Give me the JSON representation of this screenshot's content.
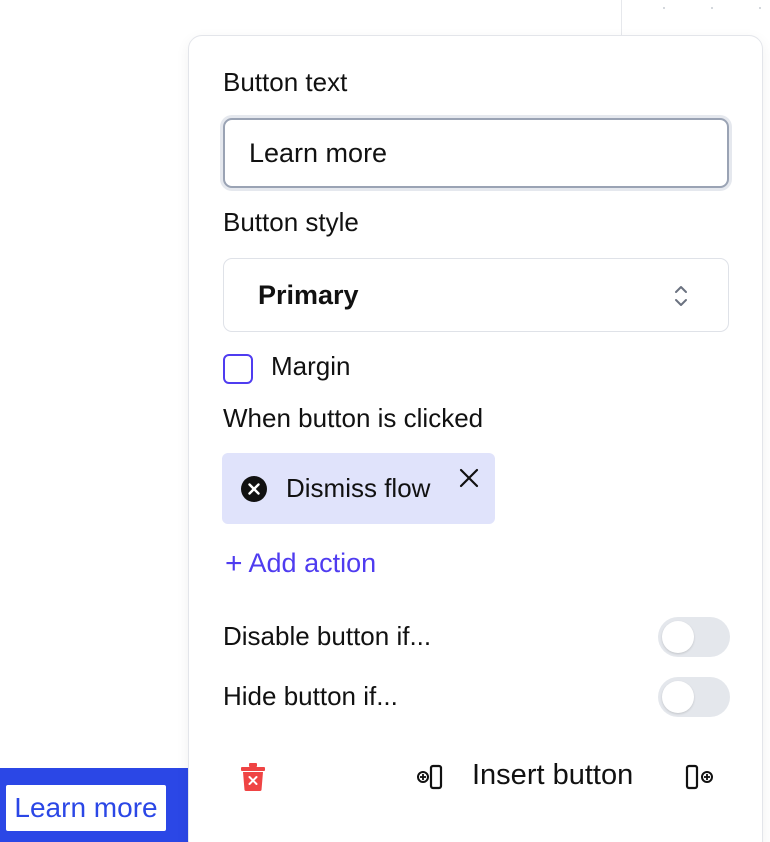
{
  "preview": {
    "button_label": "Learn more"
  },
  "panel": {
    "button_text_label": "Button text",
    "button_text_value": "Learn more",
    "button_style_label": "Button style",
    "button_style_selected": "Primary",
    "margin_label": "Margin",
    "margin_checked": false,
    "click_label": "When button is clicked",
    "actions": [
      {
        "label": "Dismiss flow",
        "icon": "x-circle-icon"
      }
    ],
    "add_action_label": "Add action",
    "disable_label": "Disable button if...",
    "disable_on": false,
    "hide_label": "Hide button if...",
    "hide_on": false,
    "insert_button_label": "Insert button"
  },
  "colors": {
    "accent": "#4f3cf0",
    "preview_bg": "#2b47e6",
    "chip_bg": "#e0e3fb",
    "danger": "#ef4444"
  }
}
